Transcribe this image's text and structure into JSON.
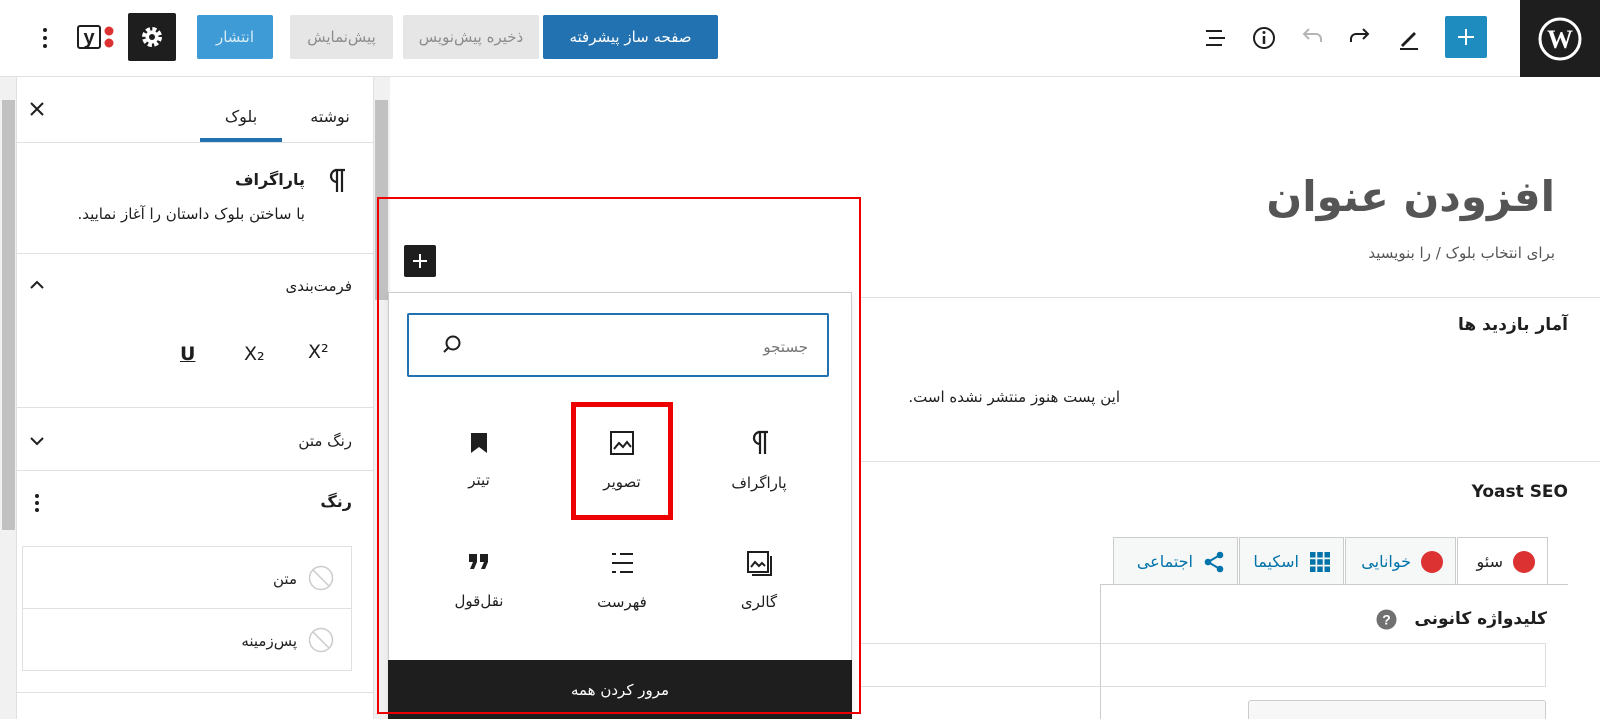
{
  "toolbar": {
    "advanced_builder_label": "صفحه ساز پیشرفته",
    "save_draft_label": "ذخیره پیش‌نویس",
    "preview_label": "پیش‌نمایش",
    "publish_label": "انتشار"
  },
  "sidebar": {
    "tabs": {
      "post": "نوشته",
      "block": "بلوک"
    },
    "block_name": "پاراگراف",
    "block_description": "با ساختن بلوک داستان را آغاز نمایید.",
    "formatting_title": "فرمت‌بندی",
    "format_buttons": {
      "underline": "U",
      "subscript": "X₂",
      "superscript": "X²"
    },
    "text_color_title": "رنگ متن",
    "color_title": "رنگ",
    "color_text_label": "متن",
    "color_background_label": "پس‌زمینه"
  },
  "editor": {
    "title_placeholder": "افزودن عنوان",
    "block_hint": "برای انتخاب بلوک / را بنویسید"
  },
  "inserter": {
    "search_placeholder": "جستجو",
    "blocks": [
      {
        "label": "پاراگراف",
        "icon": "paragraph-icon"
      },
      {
        "label": "تصویر",
        "icon": "image-icon"
      },
      {
        "label": "تیتر",
        "icon": "bookmark-icon"
      },
      {
        "label": "گالری",
        "icon": "gallery-icon"
      },
      {
        "label": "فهرست",
        "icon": "list-icon"
      },
      {
        "label": "نقل‌قول",
        "icon": "quote-icon"
      }
    ],
    "browse_all_label": "مرور کردن همه"
  },
  "stats_box": {
    "title": "آمار بازدید ها",
    "message": "این پست هنوز منتشر نشده است."
  },
  "yoast": {
    "title": "Yoast SEO",
    "tabs": {
      "seo": "سئو",
      "readability": "خوانایی",
      "schema": "اسکیما",
      "social": "اجتماعی"
    },
    "focus_keyphrase_label": "کلیدواژه کانونی"
  },
  "colors": {
    "accent": "#2271b1",
    "dark": "#1e1e1e",
    "highlight": "#ee0000",
    "seo_dot": "#dc3232"
  }
}
